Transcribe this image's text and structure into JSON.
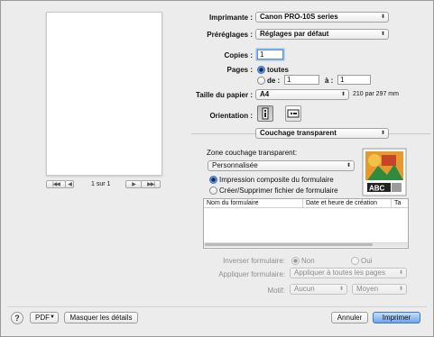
{
  "preview": {
    "page_counter": "1 sur 1",
    "first_label": "|◀◀",
    "prev_label": "◀",
    "next_label": "▶",
    "last_label": "▶▶|"
  },
  "printer": {
    "label": "Imprimante :",
    "value": "Canon PRO-10S series"
  },
  "presets": {
    "label": "Préréglages :",
    "value": "Réglages par défaut"
  },
  "copies": {
    "label": "Copies :",
    "value": "1"
  },
  "pages": {
    "label": "Pages :",
    "all_label": "toutes",
    "from_label": "de :",
    "from_value": "1",
    "to_label": "à :",
    "to_value": "1"
  },
  "paper_size": {
    "label": "Taille du papier :",
    "value": "A4",
    "dimensions": "210 par 297 mm"
  },
  "orientation": {
    "label": "Orientation :"
  },
  "panel": {
    "value": "Couchage transparent"
  },
  "coating": {
    "area_label": "Zone couchage transparent:",
    "area_value": "Personnalisée",
    "option_composite": "Impression composite du formulaire",
    "option_manage": "Créer/Supprimer fichier de formulaire",
    "preview_text": "ABC"
  },
  "form_table": {
    "columns": [
      "Nom du formulaire",
      "Date et heure de création",
      "Ta"
    ]
  },
  "invert": {
    "label": "Inverser formulaire:",
    "no": "Non",
    "yes": "Oui"
  },
  "apply": {
    "label": "Appliquer formulaire:",
    "value": "Appliquer à toutes les pages"
  },
  "pattern": {
    "label": "Motif:",
    "value": "Aucun",
    "density": "Moyen"
  },
  "footer": {
    "help": "?",
    "pdf": "PDF",
    "hide_details": "Masquer les détails",
    "cancel": "Annuler",
    "print": "Imprimer"
  },
  "colors": {
    "accent": "#3f7fd2",
    "default_button": "#6ea6e8"
  }
}
